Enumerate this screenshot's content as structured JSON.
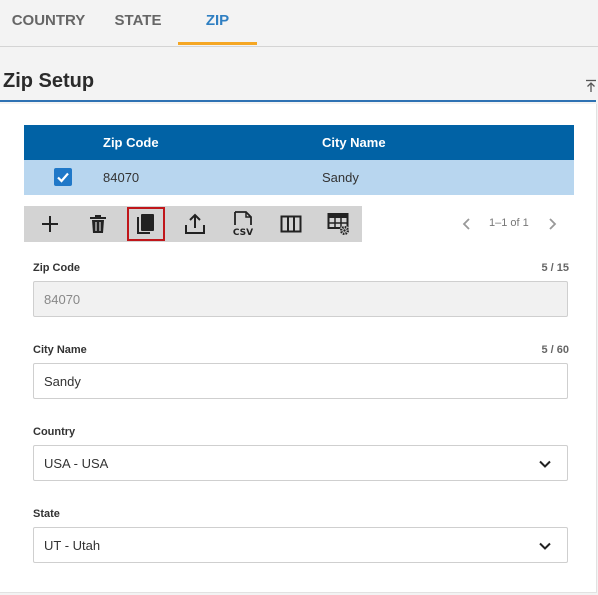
{
  "tabs": [
    {
      "label": "COUNTRY",
      "active": false
    },
    {
      "label": "STATE",
      "active": false
    },
    {
      "label": "ZIP",
      "active": true
    }
  ],
  "section": {
    "title": "Zip Setup"
  },
  "grid": {
    "columns": [
      "Zip Code",
      "City Name"
    ],
    "rows": [
      {
        "selected": true,
        "zip_code": "84070",
        "city_name": "Sandy"
      }
    ]
  },
  "toolbar": {
    "buttons": [
      {
        "icon": "plus-icon",
        "name": "add"
      },
      {
        "icon": "trash-icon",
        "name": "delete"
      },
      {
        "icon": "copy-icon",
        "name": "copy",
        "highlighted": true
      },
      {
        "icon": "upload-icon",
        "name": "export"
      },
      {
        "icon": "csv-icon",
        "name": "csv-export"
      },
      {
        "icon": "columns-icon",
        "name": "columns"
      },
      {
        "icon": "table-settings-icon",
        "name": "table-settings"
      }
    ]
  },
  "pager": {
    "text": "1–1 of 1"
  },
  "form": {
    "zip_code": {
      "label": "Zip Code",
      "count": "5 / 15",
      "value": "84070",
      "readonly": true
    },
    "city_name": {
      "label": "City Name",
      "count": "5 / 60",
      "value": "Sandy"
    },
    "country": {
      "label": "Country",
      "value": "USA - USA"
    },
    "state": {
      "label": "State",
      "value": "UT - Utah"
    }
  },
  "colors": {
    "accent": "#2f7fc2",
    "header": "#0162a5",
    "selected_row": "#b8d6ef",
    "tab_underline": "#f5a623",
    "highlight_border": "#c0161a"
  }
}
